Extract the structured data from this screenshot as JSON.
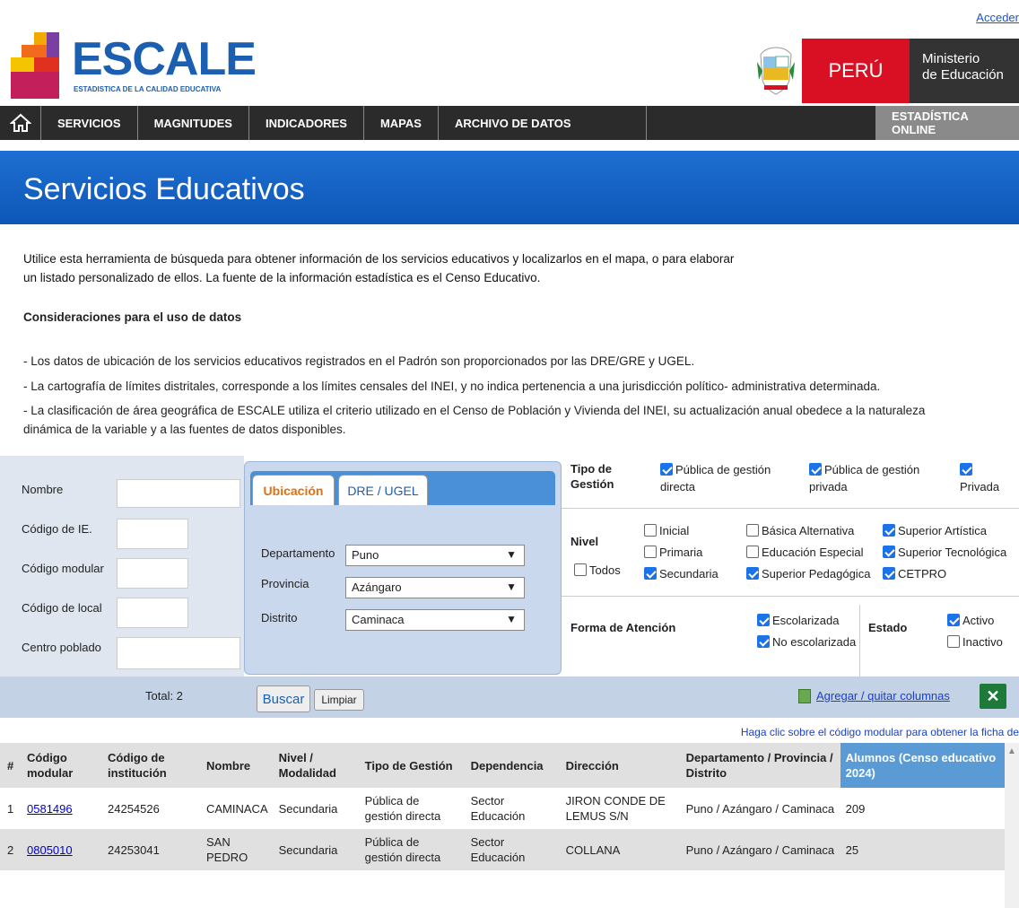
{
  "header": {
    "login_link": "Acceder",
    "logo_text": "ESCALE",
    "logo_subtitle": "ESTADISTICA DE LA CALIDAD EDUCATIVA",
    "peru_label": "PERÚ",
    "ministry_line1": "Ministerio",
    "ministry_line2": "de Educación"
  },
  "nav": {
    "items": [
      "SERVICIOS",
      "MAGNITUDES",
      "INDICADORES",
      "MAPAS",
      "ARCHIVO DE DATOS"
    ],
    "right_item": "ESTADÍSTICA ONLINE"
  },
  "page": {
    "title": "Servicios Educativos",
    "intro_line1": "Utilice esta herramienta de búsqueda para obtener información de los servicios educativos y localizarlos en el mapa, o para elaborar",
    "intro_line2": "un listado personalizado de ellos. La fuente de la información estadística es el Censo Educativo.",
    "considerations_title": "Consideraciones para el uso de datos",
    "consideration1": "- Los datos de ubicación de los servicios educativos registrados en el Padrón son  proporcionados por las DRE/GRE y UGEL.",
    "consideration2": "- La cartografía de límites distritales, corresponde a los  límites censales del INEI, y no indica pertenencia a una jurisdicción político-   administrativa determinada.",
    "consideration3a": "- La clasificación de área geográfica de ESCALE utiliza el criterio utilizado en el Censo de Población y Vivienda del INEI, su actualización anual obedece a la naturaleza",
    "consideration3b": "dinámica de la variable y a las fuentes de datos disponibles."
  },
  "form": {
    "nombre_label": "Nombre",
    "codigo_ie_label": "Código de IE.",
    "codigo_modular_label": "Código modular",
    "codigo_local_label": "Código de local",
    "centro_poblado_label": "Centro poblado",
    "tab_ubicacion": "Ubicación",
    "tab_dre": "DRE / UGEL",
    "departamento_label": "Departamento",
    "departamento_value": "Puno",
    "provincia_label": "Provincia",
    "provincia_value": "Azángaro",
    "distrito_label": "Distrito",
    "distrito_value": "Caminaca"
  },
  "filters": {
    "tipo_gestion_label1": "Tipo de",
    "tipo_gestion_label2": "Gestión",
    "publica_directa_1": "Pública de gestión",
    "publica_directa_2": "directa",
    "publica_privada_1": "Pública de gestión",
    "publica_privada_2": "privada",
    "privada": "Privada",
    "nivel_label": "Nivel",
    "todos": "Todos",
    "inicial": "Inicial",
    "primaria": "Primaria",
    "secundaria": "Secundaria",
    "basica_alternativa": "Básica Alternativa",
    "educacion_especial": "Educación Especial",
    "superior_pedagogica": "Superior Pedagógica",
    "superior_artistica": "Superior Artística",
    "superior_tecnologica": "Superior Tecnológica",
    "cetpro": "CETPRO",
    "forma_atencion_label": "Forma de Atención",
    "escolarizada": "Escolarizada",
    "no_escolarizada": "No escolarizada",
    "estado_label": "Estado",
    "activo": "Activo",
    "inactivo": "Inactivo"
  },
  "toolbar": {
    "total": "Total: 2",
    "buscar": "Buscar",
    "limpiar": "Limpiar",
    "columns_link": "Agregar / quitar columnas",
    "note": "Haga clic sobre el código modular para obtener la ficha de"
  },
  "table": {
    "headers": [
      "#",
      "Código modular",
      "Código de institución",
      "Nombre",
      "Nivel / Modalidad",
      "Tipo de Gestión",
      "Dependencia",
      "Dirección",
      "Departamento / Provincia / Distrito",
      "Alumnos (Censo educativo 2024)"
    ],
    "rows": [
      [
        "1",
        "0581496",
        "24254526",
        "CAMINACA",
        "Secundaria",
        "Pública de gestión directa",
        "Sector Educación",
        "JIRON CONDE DE LEMUS S/N",
        "Puno / Azángaro / Caminaca",
        "209"
      ],
      [
        "2",
        "0805010",
        "24253041",
        "SAN PEDRO",
        "Secundaria",
        "Pública de gestión directa",
        "Sector Educación",
        "COLLANA",
        "Puno / Azángaro / Caminaca",
        "25"
      ]
    ]
  }
}
